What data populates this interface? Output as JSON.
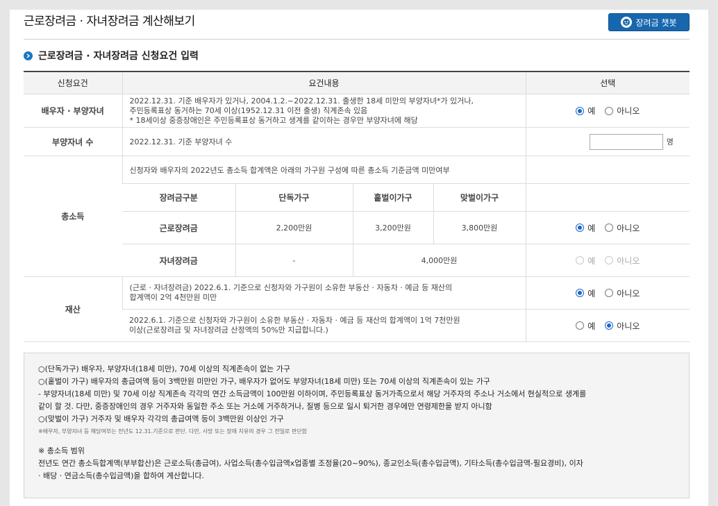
{
  "header": {
    "title": "근로장려금 · 자녀장려금 계산해보기",
    "chatbot_label": "장려금 챗봇"
  },
  "section": {
    "title": "근로장려금 · 자녀장려금 신청요건 입력"
  },
  "table": {
    "headers": [
      "신청요건",
      "요건내용",
      "선택"
    ],
    "spouse": {
      "label": "배우자 · 부양자녀",
      "lines": [
        "2022.12.31. 기준 배우자가 있거나, 2004.1.2.~2022.12.31. 출생한 18세 미만의 부양자녀*가 있거나,",
        "주민등록표상 동거하는 70세 이상(1952.12.31 이전 출생) 직계존속 있음",
        "* 18세이상 중증장애인은 주민등록표상 동거하고 생계를 같이하는 경우만 부양자녀에 해당"
      ],
      "yes": "예",
      "no": "아니오",
      "selected": "yes"
    },
    "children": {
      "label": "부양자녀 수",
      "desc": "2022.12.31. 기준 부양자녀 수",
      "value": "",
      "unit": "명"
    },
    "income": {
      "label": "총소득",
      "desc": "신청자와 배우자의 2022년도 총소득 합계액은 아래의 가구원 구성에 따른 총소득 기준금액 미만여부",
      "sub_headers": [
        "장려금구분",
        "단독가구",
        "홑벌이가구",
        "맞벌이가구"
      ],
      "work_row": {
        "name": "근로장려금",
        "single": "2,200만원",
        "one": "3,200만원",
        "dual": "3,800만원",
        "yes": "예",
        "no": "아니오",
        "selected": "yes"
      },
      "child_row": {
        "name": "자녀장려금",
        "single": "-",
        "combined": "4,000만원",
        "yes": "예",
        "no": "아니오",
        "selected": "none"
      }
    },
    "property": {
      "label": "재산",
      "row1_lines": [
        "(근로 · 자녀장려금) 2022.6.1. 기준으로 신청자와 가구원이 소유한 부동산 · 자동차 · 예금 등 재산의",
        "합계액이 2억 4천만원 미만"
      ],
      "row1": {
        "yes": "예",
        "no": "아니오",
        "selected": "yes"
      },
      "row2_lines": [
        "2022.6.1. 기준으로 신청자와 가구원이 소유한 부동산 · 자동차 · 예금 등 재산의 합계액이 1억 7천만원",
        "이상(근로장려금 및 자녀장려금 산정액의 50%만 지급합니다.)"
      ],
      "row2": {
        "yes": "예",
        "no": "아니오",
        "selected": "no"
      }
    }
  },
  "notes": {
    "lines": [
      "○(단독가구) 배우자, 부양자녀(18세 미만), 70세 이상의 직계존속이 없는 가구",
      "○(홑벌이 가구) 배우자의 총급여액 등이 3백만원 미만인 가구, 배우자가 없어도 부양자녀(18세 미만) 또는 70세 이상의 직계존속이 있는 가구",
      "- 부양자녀(18세 미만) 및 70세 이상 직계존속 각각의 연간 소득금액이 100만원 이하이며, 주민등록표상 동거가족으로서 해당 거주자의 주소나 거소에서 현실적으로 생계를",
      "같이 할 것. 다만, 중증장애인의 경우 거주자와 동일한 주소 또는 거소에 거주하거나, 질병 등으로 일시 퇴거한 경우에만 연령제한을 받지 아니함",
      "○(맞벌이 가구) 거주자 및 배우자 각각의 총급여액 등이 3백만원 이상인 가구"
    ],
    "small_note": "※배우자, 부양자녀 등 해당여부는 전년도 12.31.기준으로 판단. 다만, 사망 또는 장애 치유의 경우 그 전일로 판단함",
    "income_title": "※ 총소득 범위",
    "income_lines": [
      "전년도 연간 총소득합계액(부부합산)은 근로소득(총급여), 사업소득(총수입금액x업종별 조정율(20~90%), 종교인소득(총수입금액), 기타소득(총수입금액-필요경비), 이자",
      "· 배당 · 연금소득(총수입금액)을 합하여 계산합니다."
    ]
  }
}
